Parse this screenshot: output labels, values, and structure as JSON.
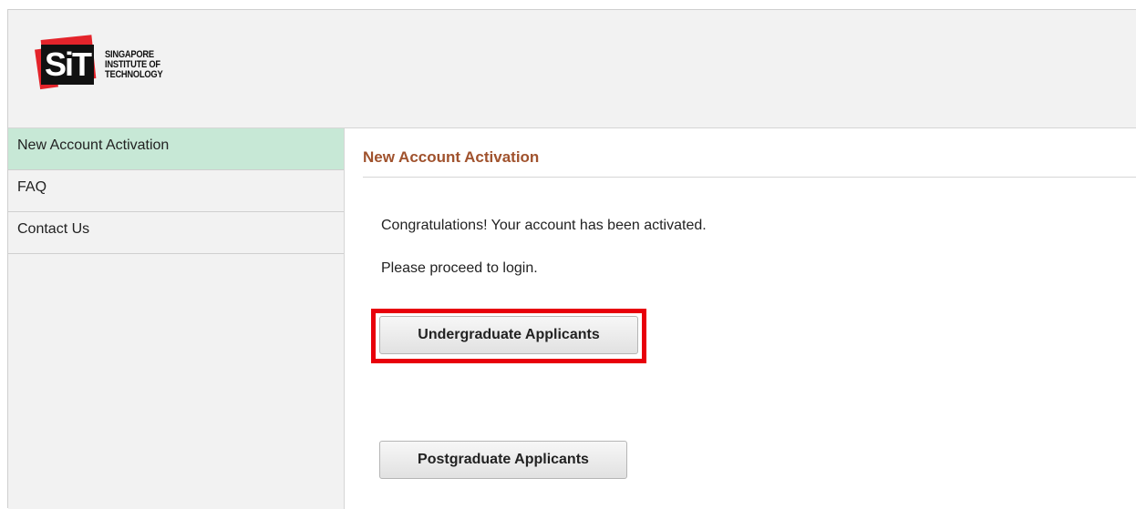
{
  "logo": {
    "text_lines": [
      "SINGAPORE",
      "INSTITUTE OF",
      "TECHNOLOGY"
    ],
    "mark_text": "SiT",
    "brand_red": "#e4242b"
  },
  "sidebar": {
    "items": [
      {
        "label": "New Account Activation",
        "active": true
      },
      {
        "label": "FAQ",
        "active": false
      },
      {
        "label": "Contact Us",
        "active": false
      }
    ],
    "active_bg": "#c7e8d6"
  },
  "main": {
    "title": "New Account Activation",
    "title_color": "#a0522d",
    "message_1": "Congratulations! Your account has been activated.",
    "message_2": "Please proceed to login.",
    "undergraduate_button": "Undergraduate Applicants",
    "postgraduate_button": "Postgraduate Applicants",
    "highlight_color": "#e8000b"
  }
}
